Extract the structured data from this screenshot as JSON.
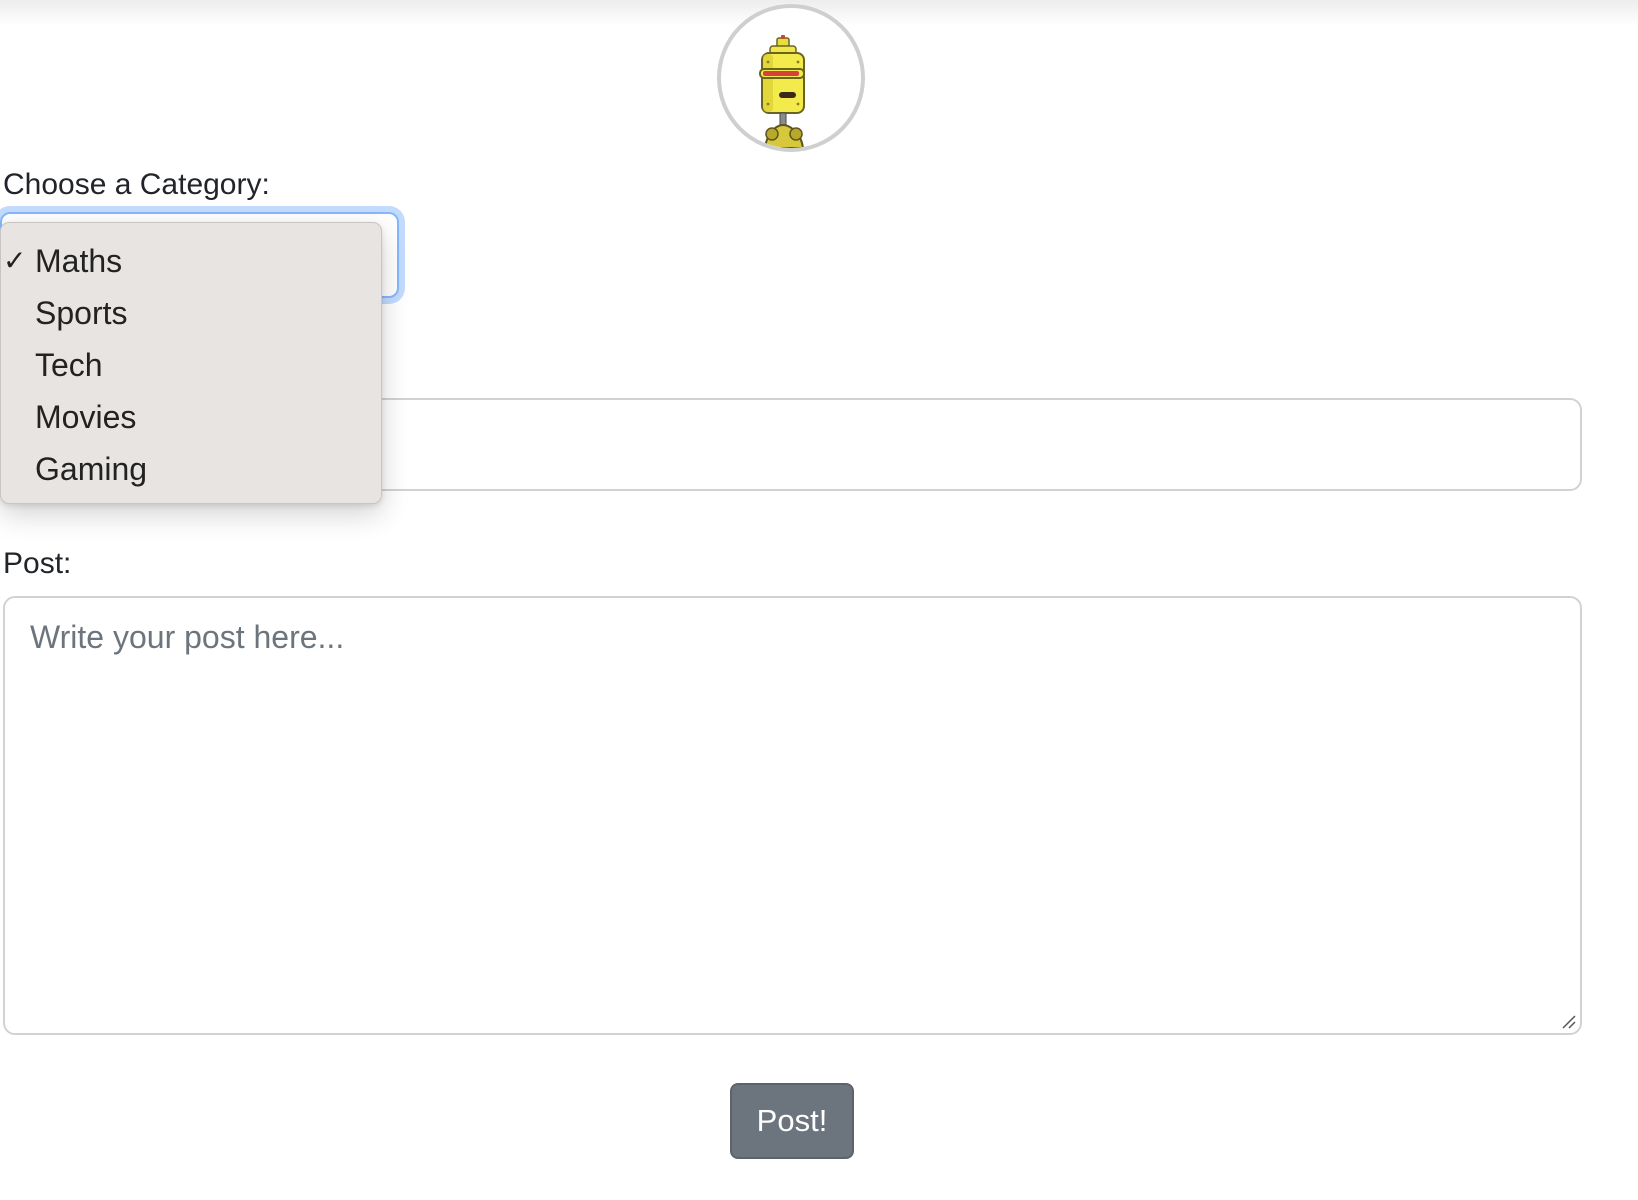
{
  "form": {
    "category_label": "Choose a Category:",
    "post_label": "Post:",
    "post_placeholder": "Write your post here...",
    "submit_label": "Post!"
  },
  "category_dropdown": {
    "selected": "Maths",
    "check_glyph": "✓",
    "options": [
      "Maths",
      "Sports",
      "Tech",
      "Movies",
      "Gaming"
    ]
  },
  "icons": {
    "avatar": "robot-avatar-icon",
    "selected_marker": "checkmark-icon",
    "resize": "resize-grip-icon"
  },
  "colors": {
    "focus_ring": "#86b7fe",
    "button_bg": "#6c757d",
    "dropdown_bg": "#e8e4e1"
  }
}
